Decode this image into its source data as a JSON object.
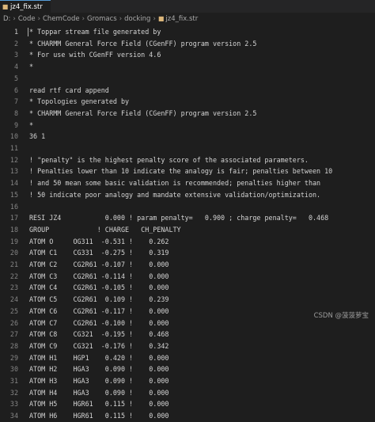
{
  "tab": {
    "label": "jz4_fix.str",
    "icon": "file-icon"
  },
  "breadcrumb": {
    "segments": [
      "D:",
      "Code",
      "ChemCode",
      "Gromacs",
      "docking"
    ],
    "file": "jz4_fix.str"
  },
  "editor": {
    "lines": [
      {
        "n": "1",
        "text": "* Toppar stream file generated by"
      },
      {
        "n": "2",
        "text": "* CHARMM General Force Field (CGenFF) program version 2.5"
      },
      {
        "n": "3",
        "text": "* For use with CGenFF version 4.6"
      },
      {
        "n": "4",
        "text": "*"
      },
      {
        "n": "5",
        "text": ""
      },
      {
        "n": "6",
        "text": "read rtf card append"
      },
      {
        "n": "7",
        "text": "* Topologies generated by"
      },
      {
        "n": "8",
        "text": "* CHARMM General Force Field (CGenFF) program version 2.5"
      },
      {
        "n": "9",
        "text": "*"
      },
      {
        "n": "10",
        "text": "36 1"
      },
      {
        "n": "11",
        "text": ""
      },
      {
        "n": "12",
        "text": "! \"penalty\" is the highest penalty score of the associated parameters."
      },
      {
        "n": "13",
        "text": "! Penalties lower than 10 indicate the analogy is fair; penalties between 10"
      },
      {
        "n": "14",
        "text": "! and 50 mean some basic validation is recommended; penalties higher than"
      },
      {
        "n": "15",
        "text": "! 50 indicate poor analogy and mandate extensive validation/optimization."
      },
      {
        "n": "16",
        "text": ""
      },
      {
        "n": "17",
        "text": "RESI JZ4           0.000 ! param penalty=   0.900 ; charge penalty=   0.468"
      },
      {
        "n": "18",
        "text": "GROUP            ! CHARGE   CH_PENALTY"
      },
      {
        "n": "19",
        "text": "ATOM O     OG311  -0.531 !    0.262"
      },
      {
        "n": "20",
        "text": "ATOM C1    CG331  -0.275 !    0.319"
      },
      {
        "n": "21",
        "text": "ATOM C2    CG2R61 -0.107 !    0.000"
      },
      {
        "n": "22",
        "text": "ATOM C3    CG2R61 -0.114 !    0.000"
      },
      {
        "n": "23",
        "text": "ATOM C4    CG2R61 -0.105 !    0.000"
      },
      {
        "n": "24",
        "text": "ATOM C5    CG2R61  0.109 !    0.239"
      },
      {
        "n": "25",
        "text": "ATOM C6    CG2R61 -0.117 !    0.000"
      },
      {
        "n": "26",
        "text": "ATOM C7    CG2R61 -0.100 !    0.000"
      },
      {
        "n": "27",
        "text": "ATOM C8    CG321  -0.195 !    0.468"
      },
      {
        "n": "28",
        "text": "ATOM C9    CG321  -0.176 !    0.342"
      },
      {
        "n": "29",
        "text": "ATOM H1    HGP1    0.420 !    0.000"
      },
      {
        "n": "30",
        "text": "ATOM H2    HGA3    0.090 !    0.000"
      },
      {
        "n": "31",
        "text": "ATOM H3    HGA3    0.090 !    0.000"
      },
      {
        "n": "32",
        "text": "ATOM H4    HGA3    0.090 !    0.000"
      },
      {
        "n": "33",
        "text": "ATOM H5    HGR61   0.115 !    0.000"
      },
      {
        "n": "34",
        "text": "ATOM H6    HGR61   0.115 !    0.000"
      }
    ]
  },
  "watermark": "CSDN @菠菠萝宝"
}
